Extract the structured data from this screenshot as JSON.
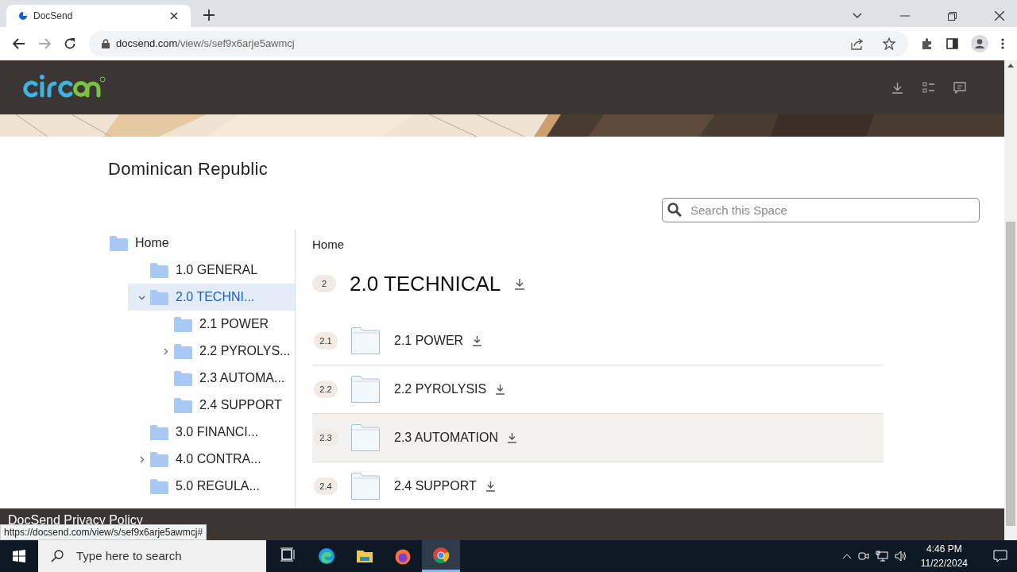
{
  "browser": {
    "tab_title": "DocSend",
    "url_host": "docsend.com",
    "url_path": "/view/s/sef9x6arje5awmcj"
  },
  "page": {
    "title": "Dominican Republic",
    "search": {
      "placeholder": "Search this Space"
    },
    "tree": [
      {
        "label": "Home",
        "selected": false,
        "children": [
          {
            "label": "1.0 GENERAL",
            "selected": false
          },
          {
            "label": "2.0 TECHNI...",
            "selected": true,
            "expanded": true,
            "children": [
              {
                "label": "2.1 POWER",
                "selected": false
              },
              {
                "label": "2.2 PYROLYS...",
                "selected": false,
                "expanded": false
              },
              {
                "label": "2.3 AUTOMA...",
                "selected": false
              },
              {
                "label": "2.4 SUPPORT",
                "selected": false
              }
            ]
          },
          {
            "label": "3.0 FINANCI...",
            "selected": false
          },
          {
            "label": "4.0 CONTRA...",
            "selected": false,
            "expanded": false
          },
          {
            "label": "5.0 REGULA...",
            "selected": false
          }
        ]
      }
    ],
    "breadcrumb": "Home",
    "folder": {
      "badge": "2",
      "title": "2.0 TECHNICAL"
    },
    "items": [
      {
        "badge": "2.1",
        "name": "2.1 POWER",
        "highlighted": false
      },
      {
        "badge": "2.2",
        "name": "2.2 PYROLYSIS",
        "highlighted": false
      },
      {
        "badge": "2.3",
        "name": "2.3 AUTOMATION",
        "highlighted": true
      },
      {
        "badge": "2.4",
        "name": "2.4 SUPPORT",
        "highlighted": false
      }
    ],
    "footer": "DocSend Privacy Policy"
  },
  "status_link": "https://docsend.com/view/s/sef9x6arje5awmcj#",
  "taskbar": {
    "search_placeholder": "Type here to search",
    "apps": [
      {
        "kind": "taskview",
        "selected": false
      },
      {
        "kind": "edge",
        "selected": false
      },
      {
        "kind": "files",
        "selected": false
      },
      {
        "kind": "firefox",
        "selected": false
      },
      {
        "kind": "chrome",
        "selected": true
      }
    ],
    "time": "4:46 PM",
    "date": "11/22/2024"
  }
}
